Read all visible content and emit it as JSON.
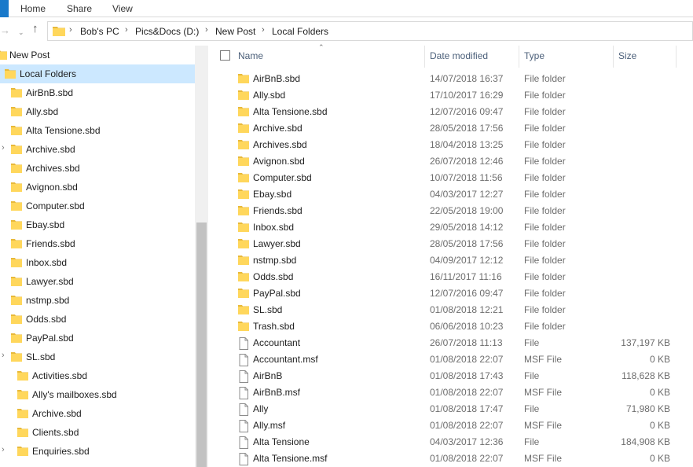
{
  "ribbon": {
    "tabs": [
      "Home",
      "Share",
      "View"
    ]
  },
  "breadcrumb": [
    "Bob's PC",
    "Pics&Docs (D:)",
    "New Post",
    "Local Folders"
  ],
  "nav": {
    "items": [
      {
        "label": "New Post",
        "level": 0,
        "selected": false,
        "chevron": false
      },
      {
        "label": "Local Folders",
        "level": 1,
        "selected": true,
        "chevron": false
      },
      {
        "label": "AirBnB.sbd",
        "level": 2,
        "selected": false,
        "chevron": false
      },
      {
        "label": "Ally.sbd",
        "level": 2,
        "selected": false,
        "chevron": false
      },
      {
        "label": "Alta Tensione.sbd",
        "level": 2,
        "selected": false,
        "chevron": false
      },
      {
        "label": "Archive.sbd",
        "level": 2,
        "selected": false,
        "chevron": true
      },
      {
        "label": "Archives.sbd",
        "level": 2,
        "selected": false,
        "chevron": false
      },
      {
        "label": "Avignon.sbd",
        "level": 2,
        "selected": false,
        "chevron": false
      },
      {
        "label": "Computer.sbd",
        "level": 2,
        "selected": false,
        "chevron": false
      },
      {
        "label": "Ebay.sbd",
        "level": 2,
        "selected": false,
        "chevron": false
      },
      {
        "label": "Friends.sbd",
        "level": 2,
        "selected": false,
        "chevron": false
      },
      {
        "label": "Inbox.sbd",
        "level": 2,
        "selected": false,
        "chevron": false
      },
      {
        "label": "Lawyer.sbd",
        "level": 2,
        "selected": false,
        "chevron": false
      },
      {
        "label": "nstmp.sbd",
        "level": 2,
        "selected": false,
        "chevron": false
      },
      {
        "label": "Odds.sbd",
        "level": 2,
        "selected": false,
        "chevron": false
      },
      {
        "label": "PayPal.sbd",
        "level": 2,
        "selected": false,
        "chevron": false
      },
      {
        "label": "SL.sbd",
        "level": 2,
        "selected": false,
        "chevron": true
      },
      {
        "label": "Activities.sbd",
        "level": 3,
        "selected": false,
        "chevron": false
      },
      {
        "label": "Ally's mailboxes.sbd",
        "level": 3,
        "selected": false,
        "chevron": false
      },
      {
        "label": "Archive.sbd",
        "level": 3,
        "selected": false,
        "chevron": false
      },
      {
        "label": "Clients.sbd",
        "level": 3,
        "selected": false,
        "chevron": false
      },
      {
        "label": "Enquiries.sbd",
        "level": 3,
        "selected": false,
        "chevron": true
      }
    ]
  },
  "columns": {
    "name": "Name",
    "date": "Date modified",
    "type": "Type",
    "size": "Size"
  },
  "files": [
    {
      "name": "AirBnB.sbd",
      "date": "14/07/2018 16:37",
      "type": "File folder",
      "size": "",
      "kind": "folder"
    },
    {
      "name": "Ally.sbd",
      "date": "17/10/2017 16:29",
      "type": "File folder",
      "size": "",
      "kind": "folder"
    },
    {
      "name": "Alta Tensione.sbd",
      "date": "12/07/2016 09:47",
      "type": "File folder",
      "size": "",
      "kind": "folder"
    },
    {
      "name": "Archive.sbd",
      "date": "28/05/2018 17:56",
      "type": "File folder",
      "size": "",
      "kind": "folder"
    },
    {
      "name": "Archives.sbd",
      "date": "18/04/2018 13:25",
      "type": "File folder",
      "size": "",
      "kind": "folder"
    },
    {
      "name": "Avignon.sbd",
      "date": "26/07/2018 12:46",
      "type": "File folder",
      "size": "",
      "kind": "folder"
    },
    {
      "name": "Computer.sbd",
      "date": "10/07/2018 11:56",
      "type": "File folder",
      "size": "",
      "kind": "folder"
    },
    {
      "name": "Ebay.sbd",
      "date": "04/03/2017 12:27",
      "type": "File folder",
      "size": "",
      "kind": "folder"
    },
    {
      "name": "Friends.sbd",
      "date": "22/05/2018 19:00",
      "type": "File folder",
      "size": "",
      "kind": "folder"
    },
    {
      "name": "Inbox.sbd",
      "date": "29/05/2018 14:12",
      "type": "File folder",
      "size": "",
      "kind": "folder"
    },
    {
      "name": "Lawyer.sbd",
      "date": "28/05/2018 17:56",
      "type": "File folder",
      "size": "",
      "kind": "folder"
    },
    {
      "name": "nstmp.sbd",
      "date": "04/09/2017 12:12",
      "type": "File folder",
      "size": "",
      "kind": "folder"
    },
    {
      "name": "Odds.sbd",
      "date": "16/11/2017 11:16",
      "type": "File folder",
      "size": "",
      "kind": "folder"
    },
    {
      "name": "PayPal.sbd",
      "date": "12/07/2016 09:47",
      "type": "File folder",
      "size": "",
      "kind": "folder"
    },
    {
      "name": "SL.sbd",
      "date": "01/08/2018 12:21",
      "type": "File folder",
      "size": "",
      "kind": "folder"
    },
    {
      "name": "Trash.sbd",
      "date": "06/06/2018 10:23",
      "type": "File folder",
      "size": "",
      "kind": "folder"
    },
    {
      "name": "Accountant",
      "date": "26/07/2018 11:13",
      "type": "File",
      "size": "137,197 KB",
      "kind": "file"
    },
    {
      "name": "Accountant.msf",
      "date": "01/08/2018 22:07",
      "type": "MSF File",
      "size": "0 KB",
      "kind": "file"
    },
    {
      "name": "AirBnB",
      "date": "01/08/2018 17:43",
      "type": "File",
      "size": "118,628 KB",
      "kind": "file"
    },
    {
      "name": "AirBnB.msf",
      "date": "01/08/2018 22:07",
      "type": "MSF File",
      "size": "0 KB",
      "kind": "file"
    },
    {
      "name": "Ally",
      "date": "01/08/2018 17:47",
      "type": "File",
      "size": "71,980 KB",
      "kind": "file"
    },
    {
      "name": "Ally.msf",
      "date": "01/08/2018 22:07",
      "type": "MSF File",
      "size": "0 KB",
      "kind": "file"
    },
    {
      "name": "Alta Tensione",
      "date": "04/03/2017 12:36",
      "type": "File",
      "size": "184,908 KB",
      "kind": "file"
    },
    {
      "name": "Alta Tensione.msf",
      "date": "01/08/2018 22:07",
      "type": "MSF File",
      "size": "0 KB",
      "kind": "file"
    }
  ],
  "icons": {
    "folder": "folder-icon",
    "file": "file-icon",
    "back": "back-arrow-icon",
    "recent": "chevron-down-icon",
    "up": "up-arrow-icon"
  },
  "colors": {
    "folder_yellow": "#ffd75c",
    "folder_dark": "#e8b93a",
    "selection": "#cce8ff",
    "header_text": "#4c607a",
    "ribbon_accent": "#1979ca"
  }
}
